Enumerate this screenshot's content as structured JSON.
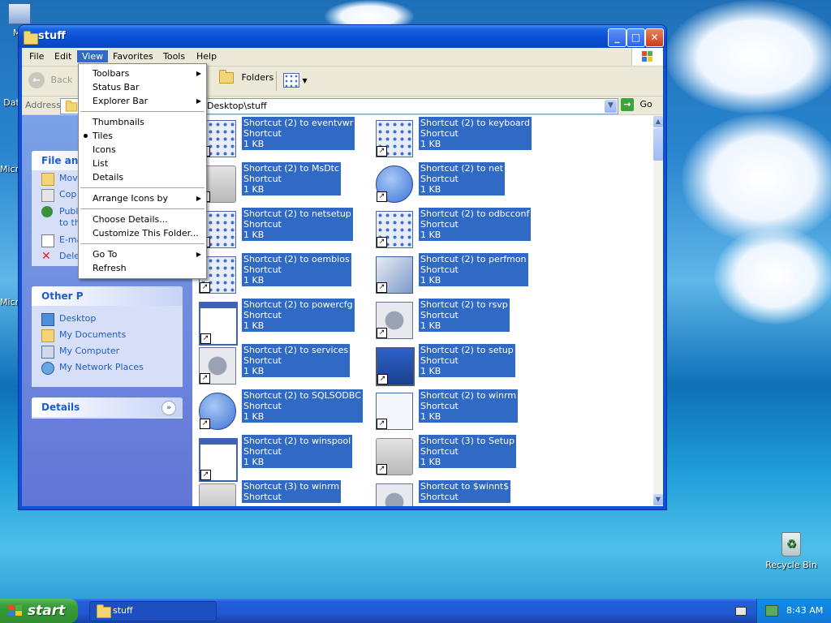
{
  "desktop": {
    "icons": [
      {
        "label": "My",
        "name": "my-documents-desktop-icon"
      },
      {
        "label": "Dat",
        "name": "data-desktop-icon"
      },
      {
        "label": "Micro",
        "name": "microsoft-desktop-icon-1"
      },
      {
        "label": "Micro",
        "name": "microsoft-desktop-icon-2"
      }
    ],
    "recycle_bin_label": "Recycle Bin"
  },
  "window": {
    "title": "stuff",
    "menu": [
      "File",
      "Edit",
      "View",
      "Favorites",
      "Tools",
      "Help"
    ],
    "active_menu": "View",
    "toolbar": {
      "back_label": "Back",
      "folders_label": "Folders"
    },
    "address": {
      "label": "Address",
      "value": "Desktop\\stuff",
      "go_label": "Go"
    }
  },
  "view_menu": {
    "items": [
      {
        "label": "Toolbars",
        "submenu": true
      },
      {
        "label": "Status Bar"
      },
      {
        "label": "Explorer Bar",
        "submenu": true
      },
      {
        "separator": true
      },
      {
        "label": "Thumbnails"
      },
      {
        "label": "Tiles",
        "selected": true
      },
      {
        "label": "Icons"
      },
      {
        "label": "List"
      },
      {
        "label": "Details"
      },
      {
        "separator": true
      },
      {
        "label": "Arrange Icons by",
        "submenu": true
      },
      {
        "separator": true
      },
      {
        "label": "Choose Details..."
      },
      {
        "label": "Customize This Folder..."
      },
      {
        "separator": true
      },
      {
        "label": "Go To",
        "submenu": true
      },
      {
        "label": "Refresh"
      }
    ]
  },
  "left_pane": {
    "file_tasks": {
      "title": "File and",
      "items": [
        "Mov",
        "Cop",
        "Publ",
        "to th",
        "E-ma",
        "Dele"
      ]
    },
    "other_places": {
      "title": "Other P",
      "items": [
        "Desktop",
        "My Documents",
        "My Computer",
        "My Network Places"
      ]
    },
    "details": {
      "title": "Details"
    }
  },
  "files": [
    {
      "name": "Shortcut (2) to eventvwr",
      "type": "Shortcut",
      "size": "1 KB",
      "icon": "eventvwr-icon"
    },
    {
      "name": "Shortcut (2) to keyboard",
      "type": "Shortcut",
      "size": "1 KB",
      "icon": "keyboard-icon"
    },
    {
      "name": "Shortcut (2) to MsDtc",
      "type": "Shortcut",
      "size": "1 KB",
      "icon": "folder-icon"
    },
    {
      "name": "Shortcut (2) to net",
      "type": "Shortcut",
      "size": "1 KB",
      "icon": "help-icon"
    },
    {
      "name": "Shortcut (2) to netsetup",
      "type": "Shortcut",
      "size": "1 KB",
      "icon": "netsetup-icon"
    },
    {
      "name": "Shortcut (2) to odbcconf",
      "type": "Shortcut",
      "size": "1 KB",
      "icon": "app-icon"
    },
    {
      "name": "Shortcut (2) to oembios",
      "type": "Shortcut",
      "size": "1 KB",
      "icon": "app-icon"
    },
    {
      "name": "Shortcut (2) to perfmon",
      "type": "Shortcut",
      "size": "1 KB",
      "icon": "perfmon-icon"
    },
    {
      "name": "Shortcut (2) to powercfg",
      "type": "Shortcut",
      "size": "1 KB",
      "icon": "window-icon"
    },
    {
      "name": "Shortcut (2) to rsvp",
      "type": "Shortcut",
      "size": "1 KB",
      "icon": "gear-doc-icon"
    },
    {
      "name": "Shortcut (2) to services",
      "type": "Shortcut",
      "size": "1 KB",
      "icon": "services-icon"
    },
    {
      "name": "Shortcut (2) to setup",
      "type": "Shortcut",
      "size": "1 KB",
      "icon": "setup-icon"
    },
    {
      "name": "Shortcut (2) to SQLSODBC",
      "type": "Shortcut",
      "size": "1 KB",
      "icon": "help-icon"
    },
    {
      "name": "Shortcut (2) to winrm",
      "type": "Shortcut",
      "size": "1 KB",
      "icon": "script-icon"
    },
    {
      "name": "Shortcut (2) to winspool",
      "type": "Shortcut",
      "size": "1 KB",
      "icon": "window-icon"
    },
    {
      "name": "Shortcut (3) to Setup",
      "type": "Shortcut",
      "size": "1 KB",
      "icon": "folder-icon"
    },
    {
      "name": "Shortcut (3) to winrm",
      "type": "Shortcut",
      "size": "",
      "icon": "folder-icon"
    },
    {
      "name": "Shortcut to $winnt$",
      "type": "Shortcut",
      "size": "",
      "icon": "gear-doc-icon"
    }
  ],
  "taskbar": {
    "start_label": "start",
    "task_label": "stuff",
    "clock": "8:43 AM"
  }
}
